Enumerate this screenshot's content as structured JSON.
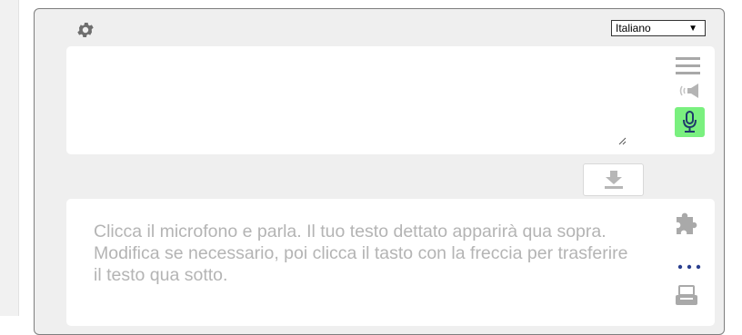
{
  "toolbar": {
    "settings_icon": "gear-icon",
    "language_selected": "Italiano",
    "language_arrow": "▼"
  },
  "input_panel": {
    "value": "",
    "icons": [
      "menu-icon",
      "speaker-icon",
      "microphone-icon"
    ],
    "mic_color": "#7af07f"
  },
  "transfer": {
    "icon": "download-arrow-icon"
  },
  "output_panel": {
    "placeholder": "Clicca il microfono e parla. Il tuo testo dettato apparirà qua sopra. Modifica se necessario, poi clicca il tasto con la freccia per trasferire il testo qua sotto.",
    "icons": [
      "puzzle-icon",
      "more-icon",
      "print-icon"
    ]
  }
}
